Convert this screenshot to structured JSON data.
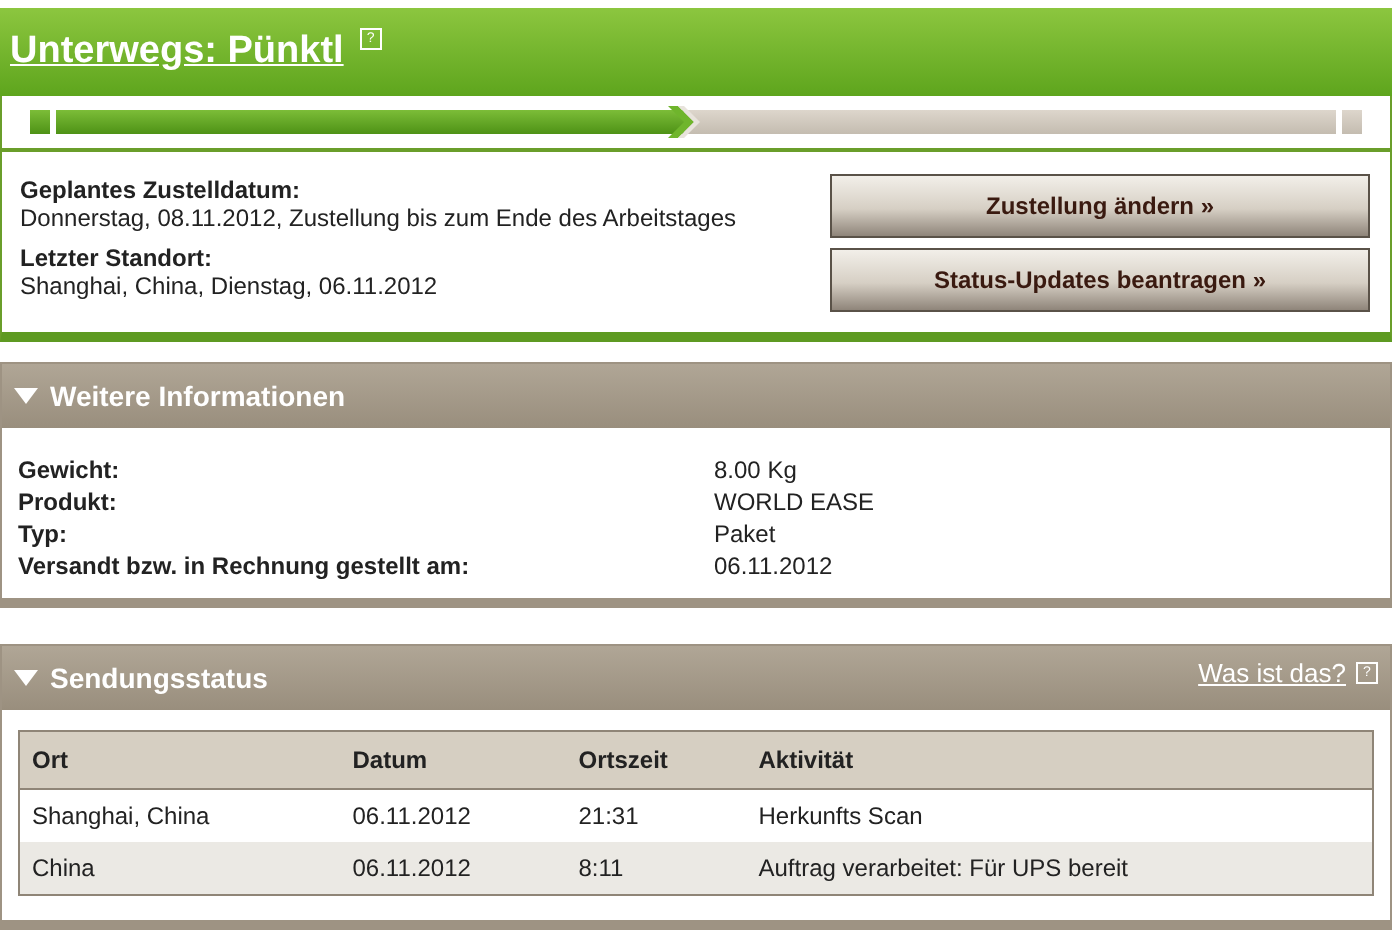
{
  "status": {
    "title": "Unterwegs: Pünktl",
    "help": "?"
  },
  "progress": {
    "level": 0.49
  },
  "delivery": [
    {
      "label": "Geplantes Zustelldatum:",
      "value": "Donnerstag, 08.11.2012, Zustellung bis zum Ende des Arbeitstages"
    },
    {
      "label": "Letzter Standort:",
      "value": "Shanghai, China, Dienstag, 06.11.2012"
    }
  ],
  "buttons": [
    "Zustellung ändern »",
    "Status-Updates beantragen »"
  ],
  "details": {
    "title": "Weitere Informationen",
    "expanded": true,
    "rows": [
      {
        "label": "Gewicht:",
        "value": "8.00 Kg"
      },
      {
        "label": "Produkt:",
        "value": "WORLD EASE"
      },
      {
        "label": "Typ:",
        "value": "Paket"
      },
      {
        "label": "Versandt bzw. in Rechnung gestellt am:",
        "value": "06.11.2012"
      }
    ]
  },
  "shipment_status": {
    "title": "Sendungsstatus",
    "expanded": true,
    "help_link": "Was ist das?",
    "help": "?",
    "table": {
      "columns": [
        "Ort",
        "Datum",
        "Ortszeit",
        "Aktivität"
      ],
      "rows": [
        [
          "Shanghai, China",
          "06.11.2012",
          "21:31",
          "Herkunfts Scan"
        ],
        [
          "China",
          "06.11.2012",
          "8:11",
          "Auftrag verarbeitet: Für UPS bereit"
        ]
      ]
    }
  }
}
